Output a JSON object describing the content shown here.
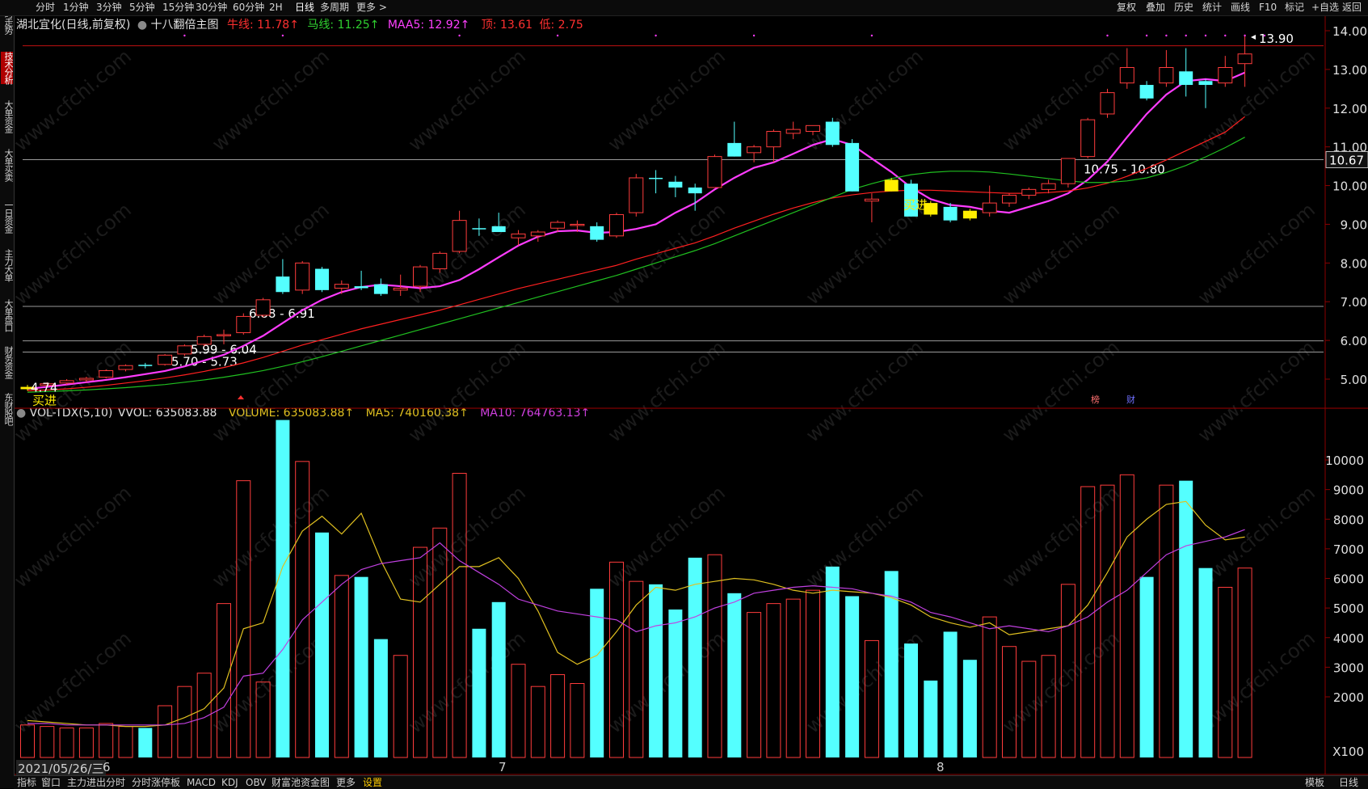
{
  "top_tabs": [
    "分时",
    "1分钟",
    "3分钟",
    "5分钟",
    "15分钟",
    "30分钟",
    "60分钟",
    "2H",
    "日线",
    "多周期",
    "更多 >"
  ],
  "top_right_tabs": [
    "复权",
    "叠加",
    "历史",
    "统计",
    "画线",
    "F10",
    "标记",
    "+自选",
    "返回"
  ],
  "side_tabs": [
    "分时走势",
    "技术分析",
    "大单资金",
    "大单买卖",
    "一日资金",
    "主力大单",
    "大单盘口",
    "财务资金",
    "东财股吧"
  ],
  "active_side_tab": "技术分析",
  "active_top_tab": "日线",
  "price_legend": {
    "stock": "湖北宜化(日线,前复权)",
    "formula": "十八翻倍主图",
    "niu": "牛线: 11.78↑",
    "ma": "马线: 11.25↑",
    "maa5": "MAA5: 12.92↑",
    "top": "顶: 13.61",
    "low": "低: 2.75"
  },
  "vol_legend": {
    "name": "VOL-TDX(5,10)",
    "vvol": "VVOL: 635083.88",
    "volume": "VOLUME: 635083.88↑",
    "ma5": "MA5: 740160.38↑",
    "ma10": "MA10: 764763.13↑"
  },
  "bottom_tabs": [
    "指标",
    "窗口",
    "主力进出分时",
    "分时涨停板",
    "MACD",
    "KDJ",
    "OBV",
    "财富池资金图",
    "更多",
    "设置"
  ],
  "bottom_right_tabs": [
    "模板",
    "日线"
  ],
  "date_label": "2021/05/26/三",
  "month_labels": [
    "6",
    "7",
    "8"
  ],
  "watermark": "www.cfchi.com",
  "annotations": {
    "buy1": "买进",
    "buy2": "买进",
    "start_price": "4.74",
    "high_price": "13.90",
    "current_price": "10.67",
    "zone1": "10.75 - 10.80",
    "zone2": "6.88 - 6.91",
    "zone3": "5.99 - 6.04",
    "zone4": "5.70 - 5.73",
    "marker_bang": "榜",
    "marker_cai": "财",
    "vol_unit": "X100"
  },
  "colors": {
    "up": "#ff3c3c",
    "down": "#54ffff",
    "signal": "#ffee00",
    "maa5": "#ff3cff",
    "niu": "#ff2020",
    "ma_line": "#20c020",
    "vol_ma5": "#e0c020",
    "vol_ma10": "#c040e0"
  },
  "chart_data": [
    {
      "type": "candlestick",
      "title": "湖北宜化(日线,前复权)",
      "ylim": [
        4.5,
        14.3
      ],
      "y_ticks": [
        5.0,
        6.0,
        7.0,
        8.0,
        9.0,
        10.0,
        11.0,
        12.0,
        13.0,
        14.0
      ],
      "h_lines": [
        13.61,
        10.67,
        6.88,
        5.99,
        5.7
      ],
      "candles": [
        {
          "o": 4.74,
          "h": 4.85,
          "l": 4.7,
          "c": 4.8,
          "signal": true
        },
        {
          "o": 4.84,
          "h": 4.92,
          "l": 4.8,
          "c": 4.88
        },
        {
          "o": 4.9,
          "h": 5.0,
          "l": 4.86,
          "c": 4.96
        },
        {
          "o": 4.98,
          "h": 5.06,
          "l": 4.92,
          "c": 5.02
        },
        {
          "o": 5.05,
          "h": 5.25,
          "l": 5.02,
          "c": 5.22
        },
        {
          "o": 5.25,
          "h": 5.38,
          "l": 5.2,
          "c": 5.35
        },
        {
          "o": 5.37,
          "h": 5.42,
          "l": 5.28,
          "c": 5.34
        },
        {
          "o": 5.38,
          "h": 5.65,
          "l": 5.35,
          "c": 5.62
        },
        {
          "o": 5.65,
          "h": 5.9,
          "l": 5.6,
          "c": 5.86
        },
        {
          "o": 5.9,
          "h": 6.15,
          "l": 5.85,
          "c": 6.1
        },
        {
          "o": 6.15,
          "h": 6.28,
          "l": 5.9,
          "c": 6.15
        },
        {
          "o": 6.2,
          "h": 6.7,
          "l": 6.15,
          "c": 6.62
        },
        {
          "o": 6.65,
          "h": 7.1,
          "l": 6.6,
          "c": 7.05
        },
        {
          "o": 7.65,
          "h": 8.1,
          "l": 7.2,
          "c": 7.25
        },
        {
          "o": 7.3,
          "h": 8.05,
          "l": 7.2,
          "c": 8.0
        },
        {
          "o": 7.85,
          "h": 7.9,
          "l": 7.25,
          "c": 7.3
        },
        {
          "o": 7.35,
          "h": 7.55,
          "l": 7.2,
          "c": 7.45
        },
        {
          "o": 7.4,
          "h": 7.8,
          "l": 7.3,
          "c": 7.35
        },
        {
          "o": 7.45,
          "h": 7.6,
          "l": 7.15,
          "c": 7.2
        },
        {
          "o": 7.3,
          "h": 7.7,
          "l": 7.15,
          "c": 7.35
        },
        {
          "o": 7.4,
          "h": 7.95,
          "l": 7.25,
          "c": 7.9
        },
        {
          "o": 7.85,
          "h": 8.3,
          "l": 7.75,
          "c": 8.25
        },
        {
          "o": 8.3,
          "h": 9.35,
          "l": 8.25,
          "c": 9.1
        },
        {
          "o": 8.9,
          "h": 9.15,
          "l": 8.7,
          "c": 8.88
        },
        {
          "o": 8.95,
          "h": 9.3,
          "l": 8.8,
          "c": 8.8
        },
        {
          "o": 8.65,
          "h": 8.85,
          "l": 8.45,
          "c": 8.75
        },
        {
          "o": 8.7,
          "h": 8.85,
          "l": 8.55,
          "c": 8.8
        },
        {
          "o": 8.9,
          "h": 9.1,
          "l": 8.8,
          "c": 9.05
        },
        {
          "o": 9.0,
          "h": 9.1,
          "l": 8.8,
          "c": 9.0
        },
        {
          "o": 8.95,
          "h": 9.05,
          "l": 8.55,
          "c": 8.6
        },
        {
          "o": 8.7,
          "h": 9.3,
          "l": 8.65,
          "c": 9.25
        },
        {
          "o": 9.3,
          "h": 10.3,
          "l": 9.2,
          "c": 10.2
        },
        {
          "o": 10.2,
          "h": 10.4,
          "l": 9.8,
          "c": 10.18
        },
        {
          "o": 10.1,
          "h": 10.25,
          "l": 9.7,
          "c": 9.95
        },
        {
          "o": 9.95,
          "h": 10.05,
          "l": 9.35,
          "c": 9.8
        },
        {
          "o": 9.95,
          "h": 10.8,
          "l": 9.95,
          "c": 10.75
        },
        {
          "o": 11.1,
          "h": 11.65,
          "l": 10.75,
          "c": 10.75
        },
        {
          "o": 10.85,
          "h": 11.05,
          "l": 10.6,
          "c": 11.0
        },
        {
          "o": 11.0,
          "h": 11.45,
          "l": 10.6,
          "c": 11.4
        },
        {
          "o": 11.35,
          "h": 11.65,
          "l": 11.2,
          "c": 11.45
        },
        {
          "o": 11.4,
          "h": 11.55,
          "l": 11.3,
          "c": 11.55
        },
        {
          "o": 11.65,
          "h": 11.75,
          "l": 11.0,
          "c": 11.05
        },
        {
          "o": 11.1,
          "h": 11.2,
          "l": 9.85,
          "c": 9.85
        },
        {
          "o": 9.6,
          "h": 9.8,
          "l": 9.05,
          "c": 9.65
        },
        {
          "o": 10.15,
          "h": 10.2,
          "l": 9.85,
          "c": 9.85,
          "signal": true
        },
        {
          "o": 10.05,
          "h": 10.15,
          "l": 9.2,
          "c": 9.2
        },
        {
          "o": 9.55,
          "h": 9.6,
          "l": 9.2,
          "c": 9.25,
          "signal": true
        },
        {
          "o": 9.45,
          "h": 9.55,
          "l": 9.05,
          "c": 9.1
        },
        {
          "o": 9.35,
          "h": 9.4,
          "l": 9.1,
          "c": 9.15,
          "signal": true
        },
        {
          "o": 9.3,
          "h": 10.0,
          "l": 9.2,
          "c": 9.55
        },
        {
          "o": 9.55,
          "h": 9.8,
          "l": 9.45,
          "c": 9.75
        },
        {
          "o": 9.75,
          "h": 9.95,
          "l": 9.65,
          "c": 9.9
        },
        {
          "o": 9.9,
          "h": 10.15,
          "l": 9.8,
          "c": 10.05
        },
        {
          "o": 10.05,
          "h": 10.7,
          "l": 9.95,
          "c": 10.7
        },
        {
          "o": 10.75,
          "h": 11.75,
          "l": 10.7,
          "c": 11.7
        },
        {
          "o": 11.85,
          "h": 12.5,
          "l": 11.75,
          "c": 12.4
        },
        {
          "o": 12.65,
          "h": 13.55,
          "l": 12.5,
          "c": 13.05
        },
        {
          "o": 12.6,
          "h": 12.7,
          "l": 12.2,
          "c": 12.25
        },
        {
          "o": 12.65,
          "h": 13.5,
          "l": 12.55,
          "c": 13.05
        },
        {
          "o": 12.95,
          "h": 13.55,
          "l": 12.3,
          "c": 12.6
        },
        {
          "o": 12.7,
          "h": 12.75,
          "l": 12.0,
          "c": 12.6
        },
        {
          "o": 12.65,
          "h": 13.35,
          "l": 12.55,
          "c": 13.05
        },
        {
          "o": 13.15,
          "h": 13.9,
          "l": 12.55,
          "c": 13.4
        }
      ],
      "series": [
        {
          "name": "MAA5",
          "values": [
            4.75,
            4.8,
            4.86,
            4.92,
            4.98,
            5.05,
            5.13,
            5.21,
            5.33,
            5.48,
            5.63,
            5.86,
            6.12,
            6.45,
            6.78,
            7.05,
            7.25,
            7.38,
            7.44,
            7.4,
            7.35,
            7.4,
            7.56,
            7.84,
            8.15,
            8.45,
            8.68,
            8.82,
            8.84,
            8.78,
            8.8,
            8.88,
            9.0,
            9.3,
            9.55,
            9.9,
            10.2,
            10.46,
            10.6,
            10.82,
            11.05,
            11.2,
            11.05,
            10.7,
            10.35,
            9.95,
            9.65,
            9.5,
            9.45,
            9.35,
            9.3,
            9.45,
            9.6,
            9.8,
            10.15,
            10.62,
            11.25,
            11.85,
            12.35,
            12.7,
            12.75,
            12.7,
            12.92
          ]
        },
        {
          "name": "牛线",
          "values": [
            4.7,
            4.72,
            4.75,
            4.79,
            4.84,
            4.9,
            4.96,
            5.03,
            5.11,
            5.2,
            5.3,
            5.42,
            5.56,
            5.72,
            5.88,
            6.02,
            6.16,
            6.3,
            6.42,
            6.54,
            6.66,
            6.78,
            6.92,
            7.06,
            7.2,
            7.34,
            7.46,
            7.58,
            7.7,
            7.82,
            7.94,
            8.1,
            8.24,
            8.38,
            8.52,
            8.7,
            8.9,
            9.08,
            9.26,
            9.42,
            9.56,
            9.68,
            9.76,
            9.82,
            9.86,
            9.88,
            9.88,
            9.86,
            9.84,
            9.82,
            9.8,
            9.8,
            9.82,
            9.86,
            9.94,
            10.06,
            10.24,
            10.44,
            10.66,
            10.9,
            11.14,
            11.38,
            11.78
          ]
        },
        {
          "name": "马线",
          "values": [
            4.66,
            4.68,
            4.7,
            4.72,
            4.75,
            4.78,
            4.82,
            4.86,
            4.92,
            4.98,
            5.05,
            5.13,
            5.22,
            5.33,
            5.45,
            5.58,
            5.72,
            5.86,
            6.0,
            6.14,
            6.28,
            6.42,
            6.56,
            6.7,
            6.84,
            6.98,
            7.12,
            7.26,
            7.4,
            7.54,
            7.68,
            7.84,
            8.0,
            8.16,
            8.32,
            8.5,
            8.7,
            8.9,
            9.1,
            9.3,
            9.5,
            9.7,
            9.9,
            10.05,
            10.18,
            10.28,
            10.34,
            10.37,
            10.37,
            10.35,
            10.3,
            10.24,
            10.18,
            10.12,
            10.08,
            10.08,
            10.12,
            10.2,
            10.34,
            10.52,
            10.74,
            10.98,
            11.25
          ]
        }
      ]
    },
    {
      "type": "bar",
      "title": "VOL-TDX(5,10)",
      "ylim": [
        0,
        11200
      ],
      "y_ticks": [
        2000,
        3000,
        4000,
        5000,
        6000,
        7000,
        8000,
        9000,
        10000
      ],
      "y_unit": "X100",
      "values": [
        1050,
        1000,
        950,
        950,
        1100,
        1000,
        950,
        1700,
        2350,
        2800,
        5150,
        9300,
        2500,
        11350,
        9950,
        7550,
        6100,
        6050,
        3950,
        3400,
        7050,
        7700,
        9550,
        4300,
        5200,
        3100,
        2350,
        2750,
        2450,
        5650,
        6550,
        5900,
        5800,
        4950,
        6700,
        6800,
        5500,
        4850,
        5150,
        5300,
        5600,
        6400,
        5400,
        3900,
        6250,
        3800,
        2550,
        4200,
        3250,
        4700,
        3700,
        3200,
        3400,
        5800,
        9100,
        9150,
        9500,
        6050,
        9150,
        9300,
        6350,
        5700,
        6350
      ],
      "series": [
        {
          "name": "MA5",
          "values": [
            1200,
            1150,
            1100,
            1050,
            1050,
            1000,
            1000,
            1050,
            1300,
            1600,
            2300,
            4300,
            4500,
            6400,
            7600,
            8100,
            7500,
            8200,
            6600,
            5300,
            5200,
            5800,
            6400,
            6400,
            6700,
            6000,
            4900,
            3500,
            3100,
            3400,
            4200,
            5100,
            5700,
            5600,
            5800,
            5900,
            6000,
            5950,
            5800,
            5600,
            5500,
            5600,
            5550,
            5500,
            5350,
            5100,
            4700,
            4500,
            4350,
            4500,
            4100,
            4200,
            4300,
            4400,
            5100,
            6200,
            7400,
            8000,
            8500,
            8600,
            7800,
            7300,
            7400
          ]
        },
        {
          "name": "MA10",
          "values": [
            1100,
            1100,
            1050,
            1050,
            1050,
            1050,
            1050,
            1050,
            1100,
            1300,
            1650,
            2700,
            2800,
            3600,
            4600,
            5200,
            5800,
            6300,
            6500,
            6600,
            6700,
            7200,
            6600,
            6200,
            5800,
            5300,
            5100,
            4900,
            4800,
            4700,
            4600,
            4200,
            4400,
            4500,
            4700,
            5000,
            5200,
            5500,
            5600,
            5700,
            5750,
            5700,
            5650,
            5500,
            5400,
            5200,
            4850,
            4700,
            4500,
            4300,
            4400,
            4300,
            4200,
            4400,
            4700,
            5200,
            5600,
            6200,
            6800,
            7100,
            7250,
            7400,
            7650
          ]
        }
      ]
    }
  ]
}
